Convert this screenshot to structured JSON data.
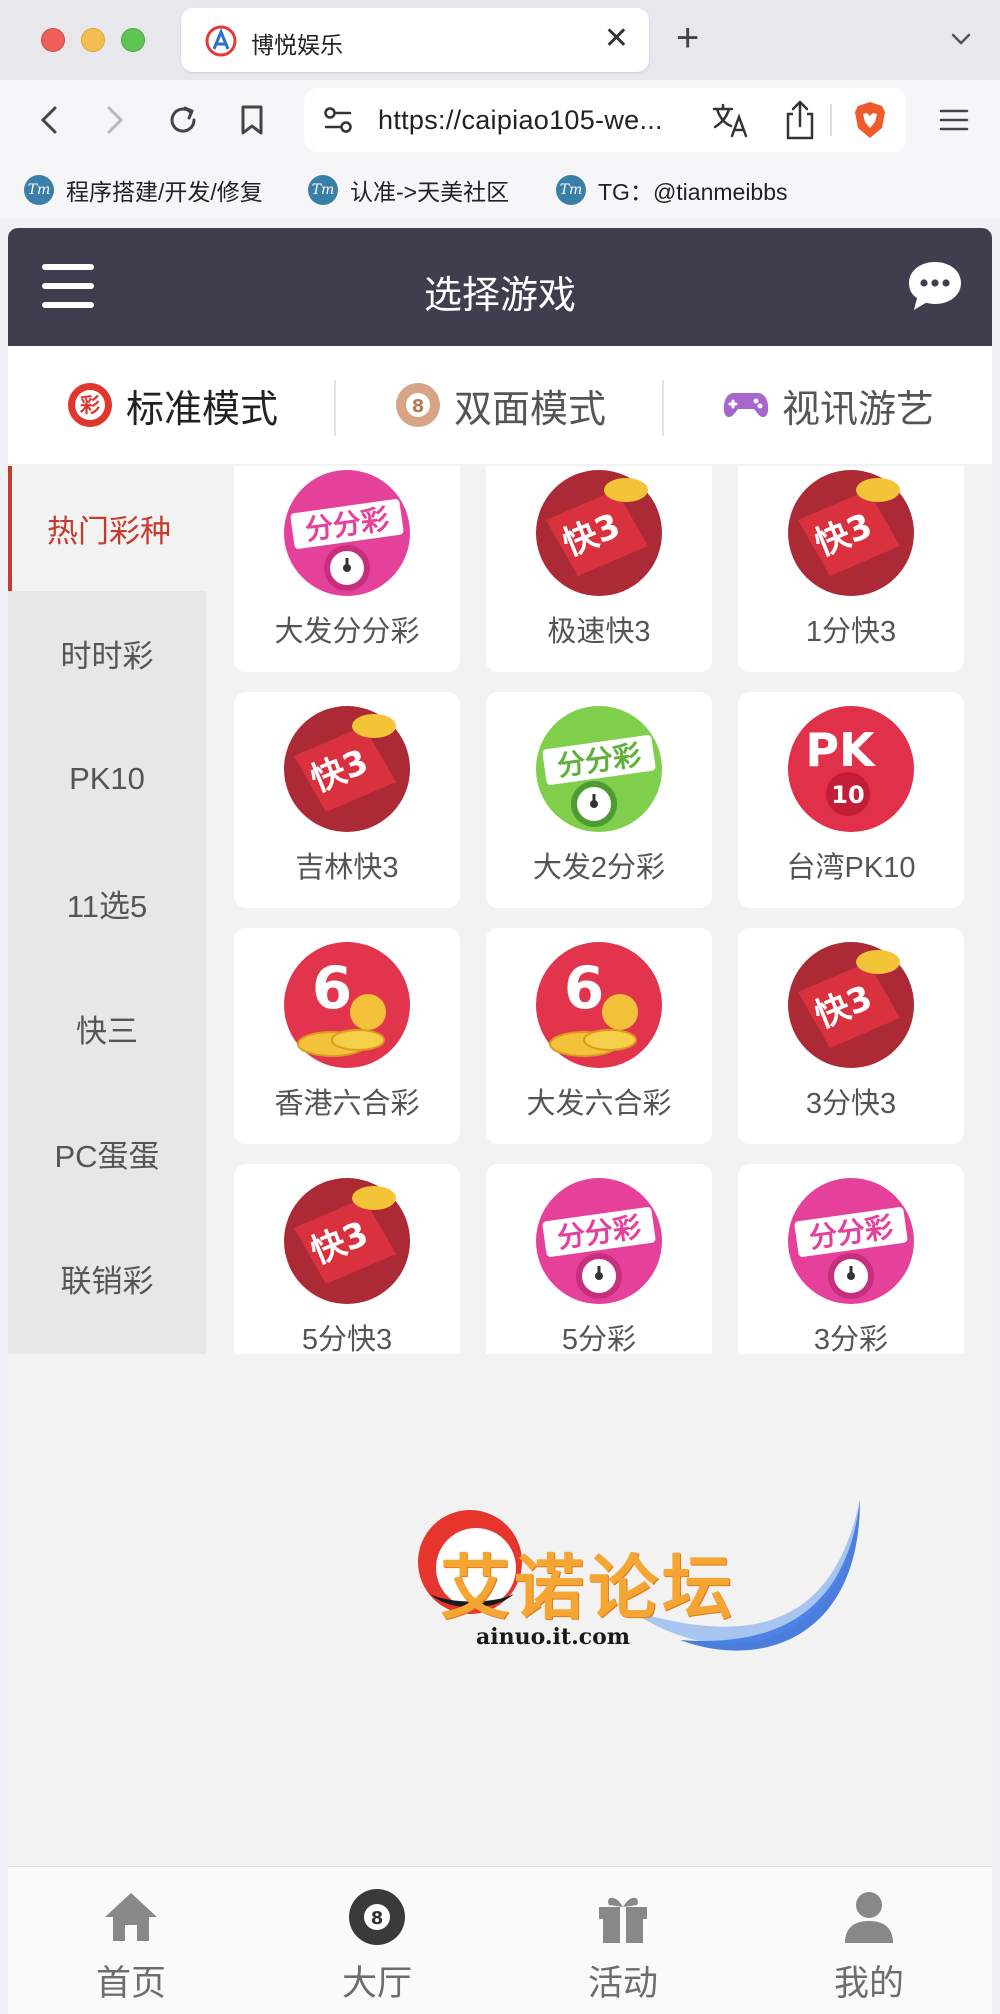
{
  "browser": {
    "tab_title": "博悦娱乐",
    "tab_close": "✕",
    "new_tab": "+",
    "url": "https://caipiao105-we...",
    "bookmarks": [
      {
        "label": "程序搭建/开发/修复",
        "icon": "Tm"
      },
      {
        "label": "认准->天美社区",
        "icon": "Tm"
      },
      {
        "label": "TG：@tianmeibbs",
        "icon": "Tm"
      }
    ]
  },
  "header": {
    "title": "选择游戏"
  },
  "mode_tabs": [
    {
      "label": "标准模式",
      "icon": "lottery-badge-icon",
      "active": true
    },
    {
      "label": "双面模式",
      "icon": "eight-ball-icon",
      "active": false
    },
    {
      "label": "视讯游艺",
      "icon": "gamepad-icon",
      "active": false
    }
  ],
  "sidebar": {
    "items": [
      {
        "label": "热门彩种",
        "active": true
      },
      {
        "label": "时时彩"
      },
      {
        "label": "PK10"
      },
      {
        "label": "11选5"
      },
      {
        "label": "快三"
      },
      {
        "label": "PC蛋蛋"
      },
      {
        "label": "联销彩"
      }
    ]
  },
  "games": [
    {
      "label": "大发分分彩",
      "icon": "fenfencai-icon",
      "badge": "分分彩"
    },
    {
      "label": "极速快3",
      "icon": "kuai3-icon",
      "badge": "快3"
    },
    {
      "label": "1分快3",
      "icon": "kuai3-icon",
      "badge": "快3"
    },
    {
      "label": "吉林快3",
      "icon": "kuai3-icon",
      "badge": "快3"
    },
    {
      "label": "大发2分彩",
      "icon": "tencent-fenfencai-icon",
      "badge": "分分彩"
    },
    {
      "label": "台湾PK10",
      "icon": "pk10-icon",
      "badge": "PK"
    },
    {
      "label": "香港六合彩",
      "icon": "liuhecai-icon",
      "badge": "6"
    },
    {
      "label": "大发六合彩",
      "icon": "liuhecai-icon",
      "badge": "6"
    },
    {
      "label": "3分快3",
      "icon": "kuai3-icon",
      "badge": "快3"
    },
    {
      "label": "5分快3",
      "icon": "kuai3-icon",
      "badge": "快3"
    },
    {
      "label": "5分彩",
      "icon": "fenfencai-icon",
      "badge": "分分彩"
    },
    {
      "label": "3分彩",
      "icon": "fenfencai-icon",
      "badge": "分分彩"
    }
  ],
  "bottom_nav": [
    {
      "label": "首页",
      "icon": "home-icon"
    },
    {
      "label": "大厅",
      "icon": "eight-ball-icon"
    },
    {
      "label": "活动",
      "icon": "gift-icon"
    },
    {
      "label": "我的",
      "icon": "user-icon"
    }
  ],
  "watermark": {
    "text": "艾诺论坛",
    "domain": "ainuo.it.com"
  },
  "colors": {
    "header_bg": "#3f3e4f",
    "accent_red": "#c73a2f",
    "sidebar_bg": "#e7e7e7"
  }
}
